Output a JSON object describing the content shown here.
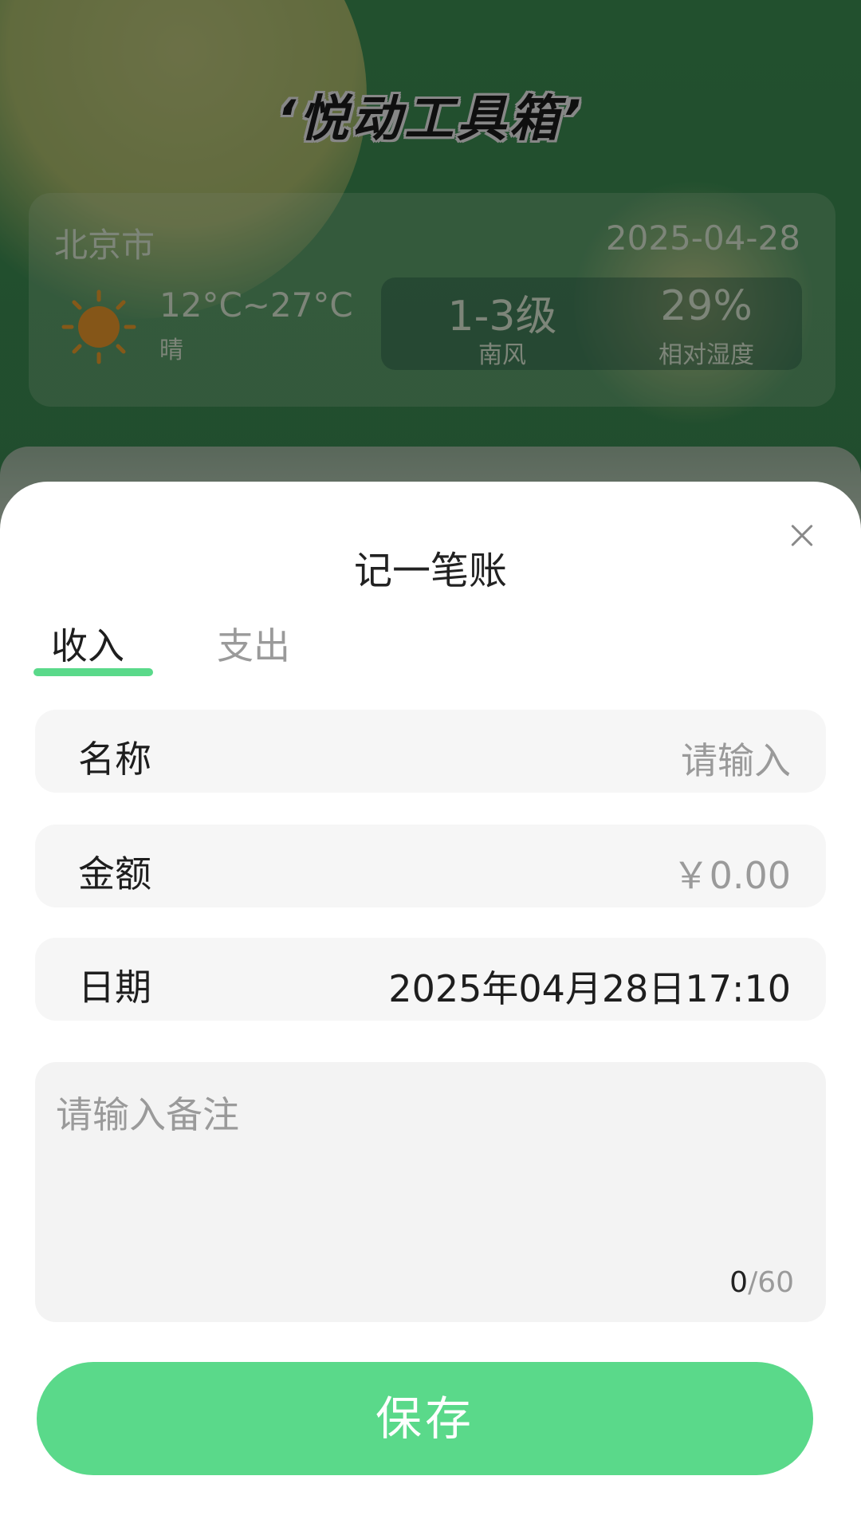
{
  "app": {
    "title": "‘悦动工具箱’"
  },
  "weather": {
    "city": "北京市",
    "date": "2025-04-28",
    "temperature": "12°C~27°C",
    "condition": "晴",
    "condition_icon": "sun-icon",
    "wind_level": "1-3级",
    "wind_direction": "南风",
    "humidity": "29%",
    "humidity_label": "相对湿度"
  },
  "sheet": {
    "title": "记一笔账",
    "tabs": [
      {
        "label": "收入",
        "active": true
      },
      {
        "label": "支出",
        "active": false
      }
    ],
    "fields": {
      "name": {
        "label": "名称",
        "placeholder": "请输入"
      },
      "amount": {
        "label": "金额",
        "placeholder": "￥0.00"
      },
      "date": {
        "label": "日期",
        "value": "2025年04月28日17:10"
      }
    },
    "note": {
      "placeholder": "请输入备注",
      "count": "0",
      "max": "/60"
    },
    "save_label": "保存"
  },
  "colors": {
    "accent": "#5ad98a",
    "background": "#3b8a50"
  }
}
